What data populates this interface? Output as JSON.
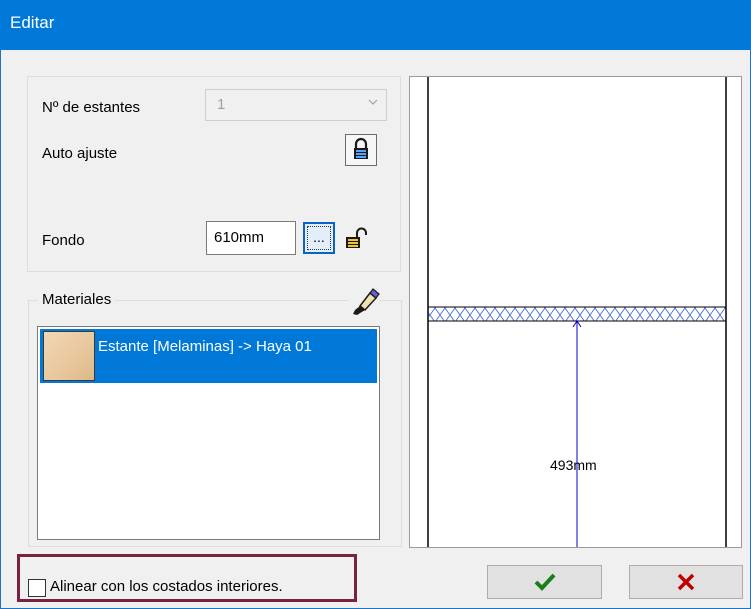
{
  "window": {
    "title": "Editar"
  },
  "shelves": {
    "label": "Nº de estantes",
    "value": "1"
  },
  "auto_fit": {
    "label": "Auto ajuste"
  },
  "depth": {
    "label": "Fondo",
    "value": "610mm",
    "browse_label": "..."
  },
  "materials": {
    "label": "Materiales",
    "items": [
      {
        "label": "Estante [Melaminas] -> Haya 01"
      }
    ]
  },
  "preview": {
    "dimension_label": "493mm"
  },
  "align_checkbox": {
    "label": "Alinear con los costados interiores.",
    "checked": false
  },
  "colors": {
    "title_bar": "#0078d7",
    "selection": "#0078d7",
    "ok_icon": "#1b7d1b",
    "cancel_icon": "#c00000",
    "dimension_line": "#0000cc",
    "highlight_border": "#7b1f45"
  },
  "icons": {
    "lock": "lock-icon",
    "padlock_open": "padlock-open-icon",
    "brush": "brush-icon",
    "ok": "checkmark-icon",
    "cancel": "x-icon"
  }
}
